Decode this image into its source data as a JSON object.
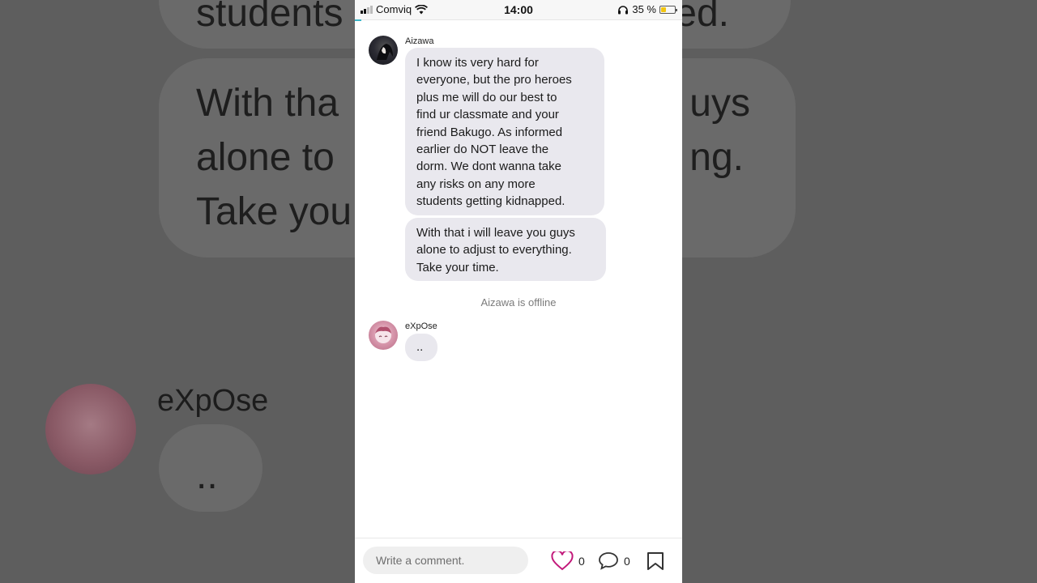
{
  "status_bar": {
    "carrier": "Comviq",
    "time": "14:00",
    "battery_percent": "35 %",
    "battery_level": 0.35
  },
  "chat": {
    "messages": [
      {
        "sender": "Aizawa",
        "avatar_icon": "aizawa-avatar",
        "bubbles": [
          [
            "I know its very hard for",
            "everyone, but the pro heroes",
            "plus me will do our best to",
            "find ur classmate and your",
            "friend Bakugo. As informed",
            "earlier do NOT leave the",
            "dorm. We dont wanna take",
            "any risks on any more",
            "students getting kidnapped."
          ],
          [
            "With that i will leave you guys",
            "alone to adjust to everything.",
            "Take your time."
          ]
        ]
      },
      {
        "sender": "eXpOse",
        "avatar_icon": "expose-avatar",
        "bubbles": [
          [
            ".."
          ]
        ]
      }
    ],
    "system_message": "Aizawa is offline"
  },
  "background": {
    "fragments": [
      "students",
      "ed.",
      "With tha",
      "uys",
      "alone to",
      "ng.",
      "Take you"
    ],
    "name": "eXpOse",
    "dots": ".."
  },
  "bottom_bar": {
    "comment_placeholder": "Write a comment.",
    "like_count": "0",
    "comment_count": "0",
    "like_color": "#c2187a"
  }
}
